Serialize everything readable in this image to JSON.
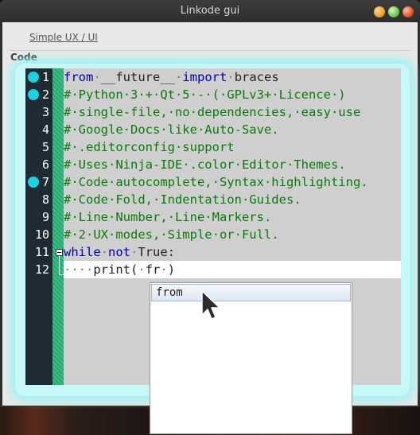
{
  "window": {
    "title": "Linkode gui"
  },
  "tabs": {
    "simple_ux": "Simple UX / UI"
  },
  "section": {
    "label": "Code"
  },
  "editor": {
    "lines": [
      {
        "num": "1",
        "marker": true,
        "segments": [
          [
            "kw",
            "from"
          ],
          [
            "ws",
            "·"
          ],
          [
            "df",
            "__future__"
          ],
          [
            "ws",
            "·"
          ],
          [
            "kw",
            "import"
          ],
          [
            "ws",
            "·"
          ],
          [
            "df",
            "braces"
          ]
        ]
      },
      {
        "num": "2",
        "marker": true,
        "segments": [
          [
            "cm",
            "#·Python·3·+·Qt·5·-·(·GPLv3+·Licence·)"
          ]
        ]
      },
      {
        "num": "3",
        "marker": false,
        "segments": [
          [
            "cm",
            "#·single-file,·no·dependencies,·easy·use"
          ]
        ]
      },
      {
        "num": "4",
        "marker": false,
        "segments": [
          [
            "cm",
            "#·Google·Docs·like·Auto-Save."
          ]
        ]
      },
      {
        "num": "5",
        "marker": false,
        "segments": [
          [
            "cm",
            "#·.editorconfig·support"
          ]
        ]
      },
      {
        "num": "6",
        "marker": false,
        "segments": [
          [
            "cm",
            "#·Uses·Ninja-IDE·.color·Editor·Themes."
          ]
        ]
      },
      {
        "num": "7",
        "marker": true,
        "segments": [
          [
            "cm",
            "#·Code·autocomplete,·Syntax·highlighting."
          ]
        ]
      },
      {
        "num": "8",
        "marker": false,
        "segments": [
          [
            "cm",
            "#·Code·Fold,·Indentation·Guides."
          ]
        ]
      },
      {
        "num": "9",
        "marker": false,
        "segments": [
          [
            "cm",
            "#·Line·Number,·Line·Markers."
          ]
        ]
      },
      {
        "num": "10",
        "marker": false,
        "segments": [
          [
            "cm",
            "#·2·UX·modes,·Simple·or·Full."
          ]
        ]
      },
      {
        "num": "11",
        "marker": false,
        "segments": [
          [
            "kw",
            "while"
          ],
          [
            "ws",
            "·"
          ],
          [
            "kw",
            "not"
          ],
          [
            "ws",
            "·"
          ],
          [
            "df",
            "True:"
          ]
        ]
      },
      {
        "num": "12",
        "marker": false,
        "segments": [
          [
            "ws",
            "····"
          ],
          [
            "df",
            "print("
          ],
          [
            "ws",
            "·"
          ],
          [
            "df",
            "fr"
          ],
          [
            "ws",
            "·"
          ],
          [
            "df",
            ")"
          ]
        ]
      }
    ],
    "current_line": 12,
    "fold_line": 11
  },
  "autocomplete": {
    "items": [
      "from"
    ]
  },
  "icons": {
    "markers": "breakpoint-marker-icon",
    "fold": "fold-toggle-icon",
    "cursor": "mouse-pointer-icon"
  },
  "colors": {
    "keyword": "#0000aa",
    "comment": "#0a7a0a",
    "marker": "#19d3e0",
    "gutter": "#1faa6e",
    "glow": "#9ff2f2"
  }
}
